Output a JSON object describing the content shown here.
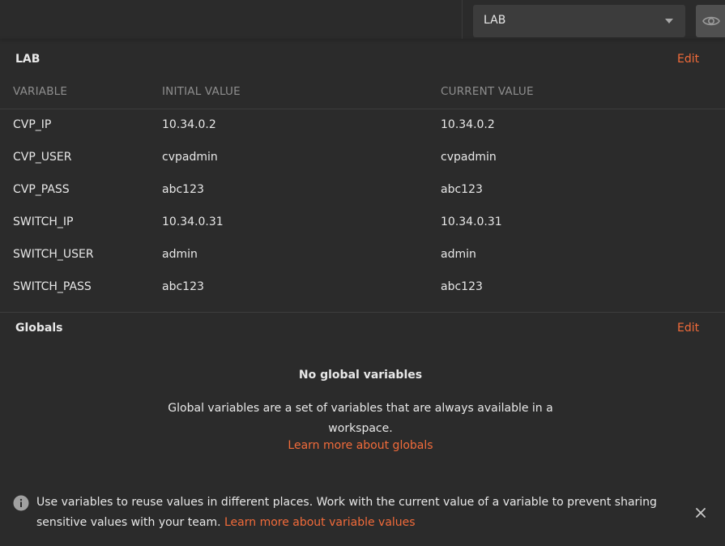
{
  "environment_selector": {
    "selected": "LAB"
  },
  "icons": {
    "eye": "eye-icon",
    "dropdown": "chevron-down-icon",
    "info": "info-icon",
    "close": "close-icon"
  },
  "env_section": {
    "title": "LAB",
    "edit_label": "Edit",
    "columns": [
      "VARIABLE",
      "INITIAL VALUE",
      "CURRENT VALUE"
    ],
    "rows": [
      {
        "variable": "CVP_IP",
        "initial": "10.34.0.2",
        "current": "10.34.0.2"
      },
      {
        "variable": "CVP_USER",
        "initial": "cvpadmin",
        "current": "cvpadmin"
      },
      {
        "variable": "CVP_PASS",
        "initial": "abc123",
        "current": "abc123"
      },
      {
        "variable": "SWITCH_IP",
        "initial": "10.34.0.31",
        "current": "10.34.0.31"
      },
      {
        "variable": "SWITCH_USER",
        "initial": "admin",
        "current": "admin"
      },
      {
        "variable": "SWITCH_PASS",
        "initial": "abc123",
        "current": "abc123"
      }
    ]
  },
  "globals_section": {
    "title": "Globals",
    "edit_label": "Edit",
    "empty_title": "No global variables",
    "empty_description": "Global variables are a set of variables that are always available in a workspace.",
    "learn_more_label": "Learn more about globals"
  },
  "info_banner": {
    "text": "Use variables to reuse values in different places. Work with the current value of a variable to prevent sharing sensitive values with your team.",
    "link_label": "Learn more about variable values"
  },
  "colors": {
    "accent": "#f26b3a",
    "background": "#2b2b2b",
    "muted": "#8e8e8e"
  }
}
